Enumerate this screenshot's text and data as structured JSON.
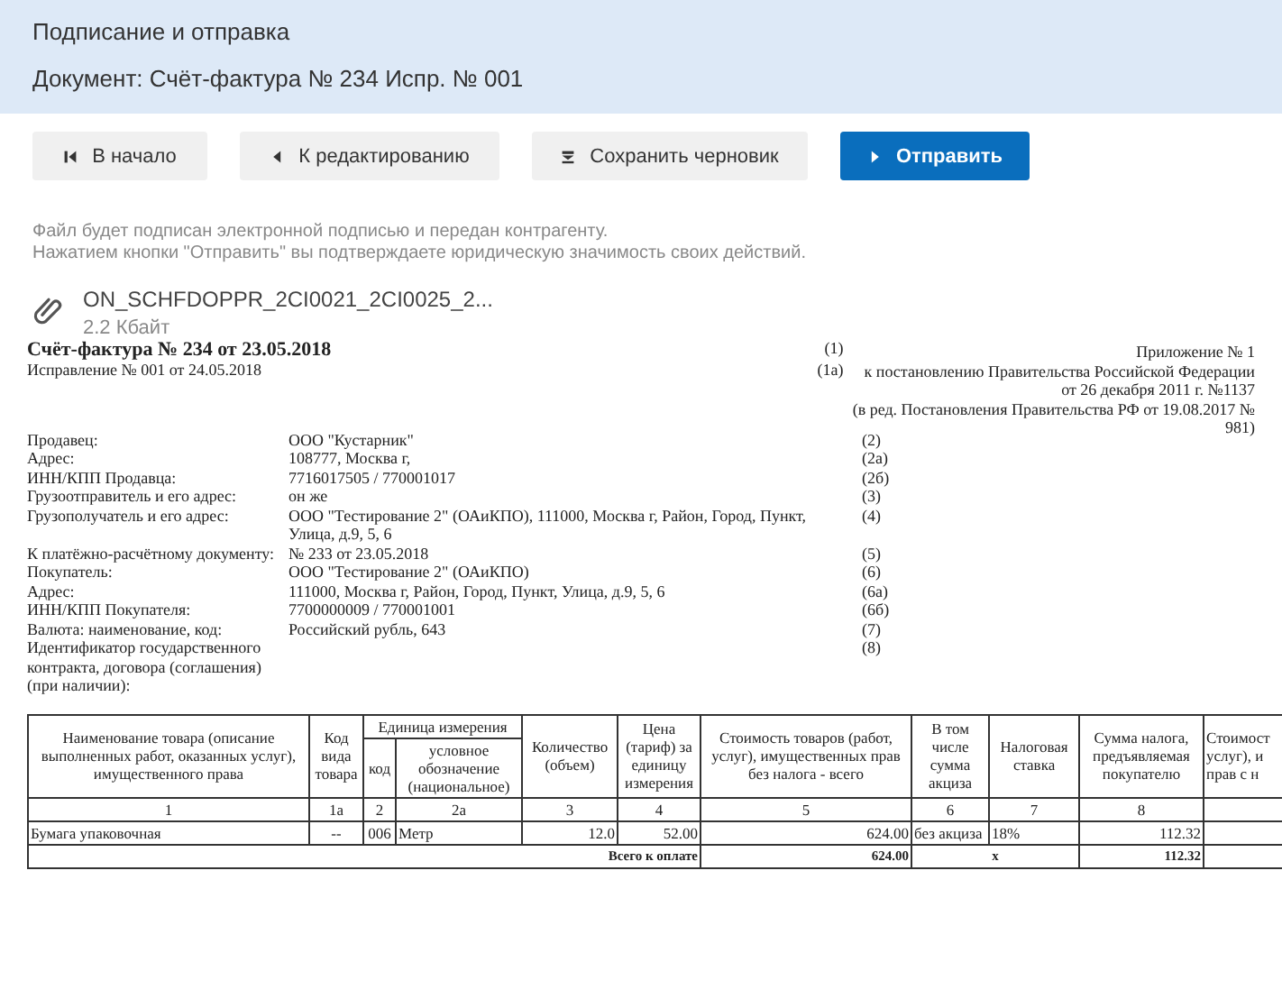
{
  "header": {
    "title": "Подписание и отправка",
    "document": "Документ: Счёт-фактура № 234 Испр. № 001"
  },
  "buttons": [
    {
      "label": "В начало",
      "kind": "secondary"
    },
    {
      "label": "К редактированию",
      "kind": "secondary"
    },
    {
      "label": "Сохранить черновик",
      "kind": "secondary"
    },
    {
      "label": "Отправить",
      "kind": "primary"
    }
  ],
  "notice": [
    "Файл будет подписан электронной подписью и передан контрагенту.",
    "Нажатием кнопки \"Отправить\" вы подтверждаете юридическую значимость своих действий."
  ],
  "file": {
    "name": "ON_SCHFDOPPR_2CI0021_2CI0025_2...",
    "size": "2.2 Кбайт"
  },
  "invoice": {
    "title": "Счёт-фактура № 234 от 23.05.2018",
    "title_code": "(1)",
    "correction": "Исправление № 001 от 24.05.2018",
    "correction_code": "(1а)",
    "appendix": [
      "Приложение № 1",
      "к постановлению Правительства Российской Федерации",
      "от 26 декабря 2011 г. №1137",
      "(в ред. Постановления Правительства РФ от 19.08.2017 № 981)"
    ],
    "fields": [
      {
        "label": "Продавец:",
        "value": "ООО \"Кустарник\"",
        "code": "(2)"
      },
      {
        "label": "Адрес:",
        "value": "108777, Москва г,",
        "code": "(2а)"
      },
      {
        "label": "ИНН/КПП Продавца:",
        "value": "7716017505 / 770001017",
        "code": "(2б)"
      },
      {
        "label": "Грузоотправитель и его адрес:",
        "value": "он же",
        "code": "(3)"
      },
      {
        "label": "Грузополучатель и его адрес:",
        "value": "ООО \"Тестирование 2\" (ОАиКПО), 111000, Москва г, Район, Город, Пункт, Улица, д.9, 5, 6",
        "code": "(4)"
      },
      {
        "label": "К платёжно-расчётному документу:",
        "value": "№ 233 от 23.05.2018",
        "code": "(5)"
      },
      {
        "label": "Покупатель:",
        "value": "ООО \"Тестирование 2\" (ОАиКПО)",
        "code": "(6)"
      },
      {
        "label": "Адрес:",
        "value": "111000, Москва г, Район, Город, Пункт, Улица, д.9, 5, 6",
        "code": "(6а)"
      },
      {
        "label": "ИНН/КПП Покупателя:",
        "value": "7700000009 / 770001001",
        "code": "(6б)"
      },
      {
        "label": "Валюта: наименование, код:",
        "value": "Российский рубль, 643",
        "code": "(7)"
      },
      {
        "label": "Идентификатор государственного контракта, договора (соглашения) (при наличии):",
        "code": "(8)"
      }
    ]
  },
  "table": {
    "group_header": "Единица измерения",
    "columns": [
      {
        "label": "Наименование товара (описание выполненных работ, оказанных услуг), имущественного права",
        "number": "1"
      },
      {
        "label": "Код вида товара",
        "number": "1а"
      },
      {
        "label": "код",
        "number": "2"
      },
      {
        "label": "условное обозначение (национальное)",
        "number": "2а"
      },
      {
        "label": "Количество (объем)",
        "number": "3"
      },
      {
        "label": "Цена (тариф) за единицу измерения",
        "number": "4"
      },
      {
        "label": "Стоимость товаров (работ, услуг), имущественных прав без налога - всего",
        "number": "5"
      },
      {
        "label": "В том числе сумма акциза",
        "number": "6"
      },
      {
        "label": "Налоговая ставка",
        "number": "7"
      },
      {
        "label": "Сумма налога, предъявляемая покупателю",
        "number": "8"
      },
      {
        "label": "Стоимост услуг), и прав с н"
      }
    ],
    "rows": [
      [
        "Бумага упаковочная",
        "--",
        "006",
        "Метр",
        "12.0",
        "52.00",
        "624.00",
        "без акциза",
        "18%",
        "112.32",
        ""
      ]
    ],
    "total": {
      "label": "Всего к оплате",
      "cost": "624.00",
      "excise": "x",
      "tax": "112.32"
    }
  }
}
